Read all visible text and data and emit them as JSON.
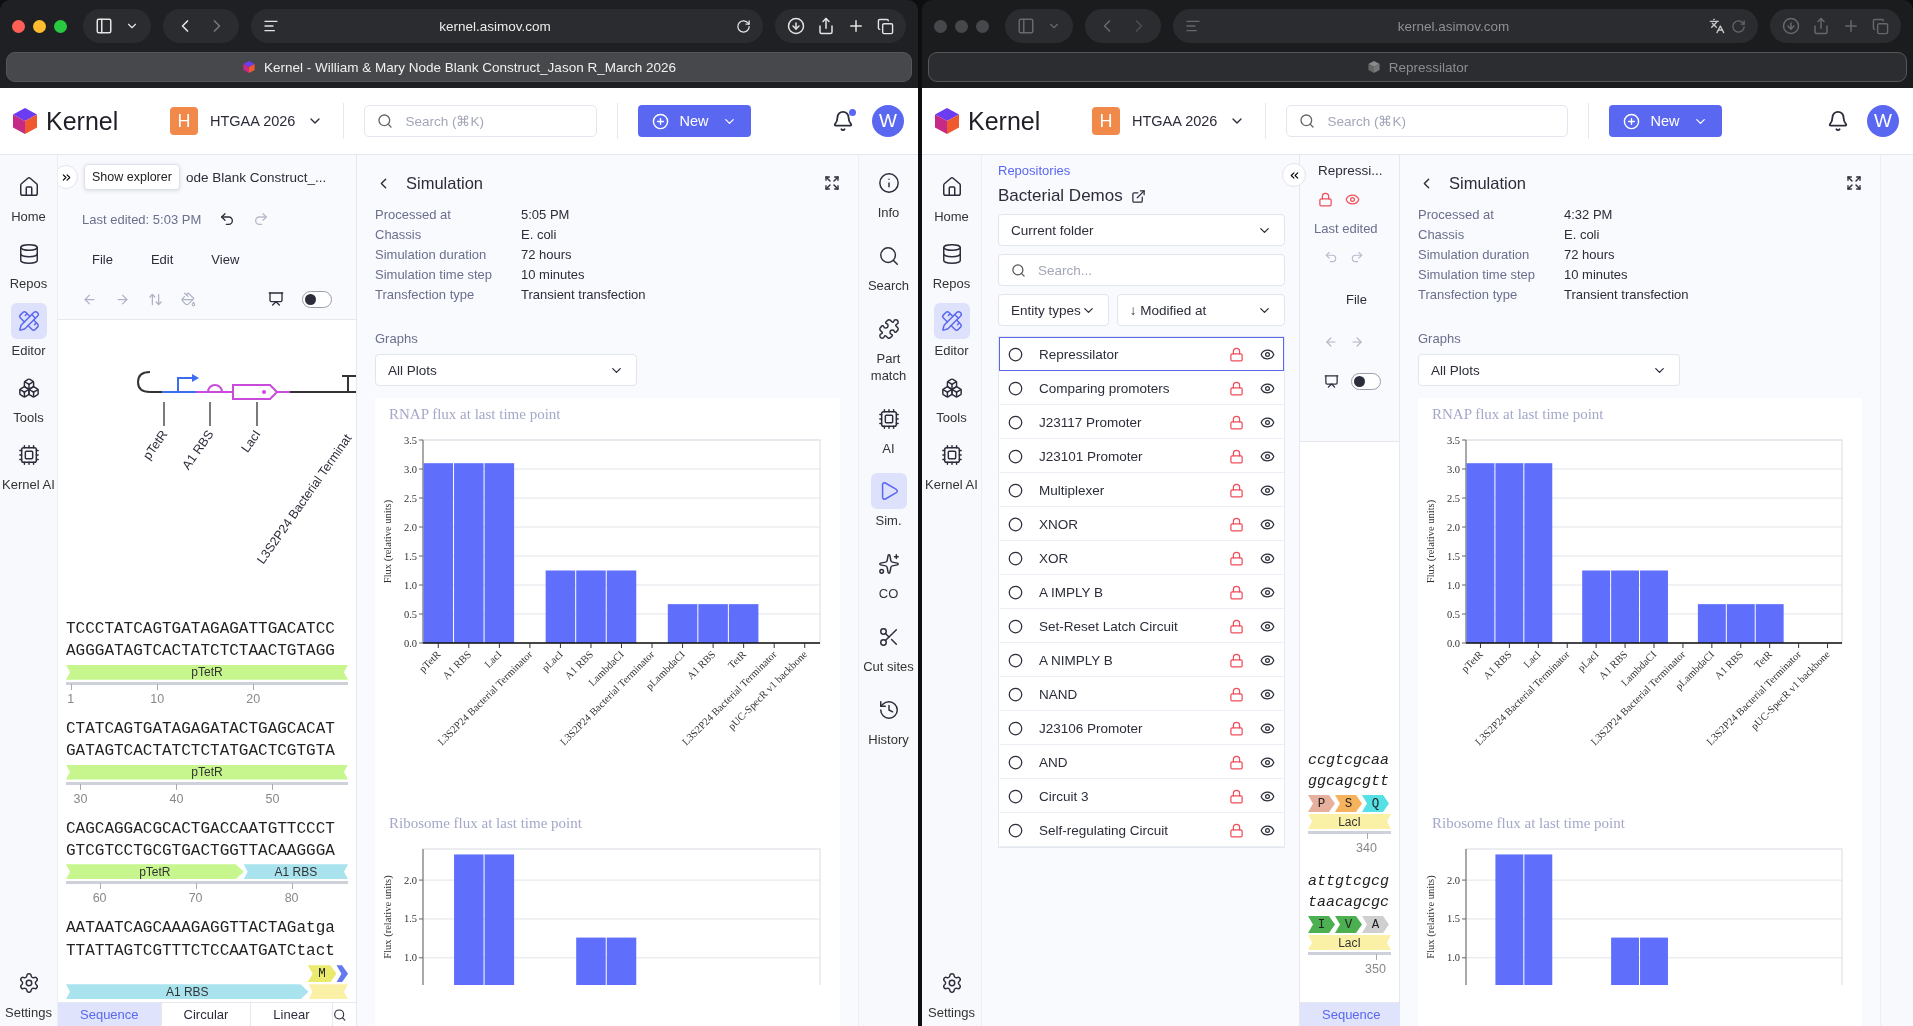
{
  "windows": [
    {
      "active": true,
      "url": "kernel.asimov.com",
      "tab_title": "Kernel - William & Mary Node Blank Construct_Jason R_March 2026",
      "app": {
        "brand": "Kernel",
        "workspace_initial": "H",
        "workspace": "HTGAA 2026",
        "search_placeholder": "Search (⌘K)",
        "new_label": "New",
        "unread": true,
        "avatar": "W"
      },
      "nav": [
        {
          "label": "Home",
          "kind": "home",
          "selected": false
        },
        {
          "label": "Repos",
          "kind": "repos",
          "selected": false
        },
        {
          "label": "Editor",
          "kind": "editor",
          "selected": true
        },
        {
          "label": "Tools",
          "kind": "tools",
          "selected": false
        },
        {
          "label": "Kernel AI",
          "kind": "ai",
          "selected": false
        }
      ],
      "settings": "Settings",
      "editor": {
        "kind": "full",
        "tooltip": "Show explorer",
        "title": "ode Blank Construct_...",
        "last_edited": "Last edited: 5:03 PM",
        "menus": [
          "File",
          "Edit",
          "View"
        ],
        "toggle_on": false,
        "diagram_labels": [
          "pTetR",
          "A1 RBS",
          "LacI",
          "L3S2P24 Bacterial Terminat"
        ],
        "blocks": [
          {
            "top": "TCCCTATCAGTGATAGAGATTGACATCC",
            "bottom": "AGGGATAGTCACTATCTCTAACTGTAGG",
            "features": [
              {
                "label": "pTetR",
                "color": "#c6f68d",
                "ends": false
              }
            ],
            "ticks": [
              "1",
              "10",
              "20"
            ]
          },
          {
            "top": "CTATCAGTGATAGAGATACTGAGCACAT",
            "bottom": "GATAGTCACTATCTCTATGACTCGTGTA",
            "features": [
              {
                "label": "pTetR",
                "color": "#c6f68d",
                "ends": false
              }
            ],
            "ticks": [
              "30",
              "40",
              "50"
            ]
          },
          {
            "top": "CAGCAGGACGCACTGACCAATGTTCCCT",
            "bottom": "GTCGTCCTGCGTGACTGGTTACAAGGGA",
            "features": [
              {
                "label": "pTetR",
                "color": "#c6f68d",
                "ends": true
              },
              {
                "label": "A1 RBS",
                "color": "#a9e3ee",
                "ends": false
              }
            ],
            "ticks": [
              "60",
              "70",
              "80"
            ]
          },
          {
            "top": "AATAATCAGCAAAGAGGTTACTAGatga",
            "bottom": "TTATTAGTCGTTTCTCCAATGATCtact",
            "aminos": [
              {
                "label": "M",
                "color": "#e9ea6e"
              },
              {
                "color": "#6478f0"
              }
            ],
            "features": [
              {
                "label": "A1 RBS",
                "color": "#a9e3ee",
                "ends": true
              },
              {
                "color": "#fbf1a6",
                "ends": false
              }
            ]
          }
        ],
        "tabs": [
          {
            "label": "Sequence",
            "selected": true
          },
          {
            "label": "Circular",
            "selected": false
          },
          {
            "label": "Linear",
            "selected": false
          }
        ]
      },
      "simulation": {
        "title": "Simulation",
        "properties": [
          {
            "label": "Processed at",
            "value": "5:05 PM"
          },
          {
            "label": "Chassis",
            "value": "E. coli"
          },
          {
            "label": "Simulation duration",
            "value": "72 hours"
          },
          {
            "label": "Simulation time step",
            "value": "10 minutes"
          },
          {
            "label": "Transfection type",
            "value": "Transient transfection"
          }
        ],
        "graphs_label": "Graphs",
        "plot_select": "All Plots",
        "charts": [
          {
            "title": "RNAP flux at last time point",
            "chart_data": {
              "type": "bar",
              "ylabel": "Flux (relative units)",
              "categories": [
                "pTetR",
                "A1 RBS",
                "LacI",
                "L3S2P24 Bacterial Terminator",
                "pLacI",
                "A1 RBS",
                "LambdaCI",
                "L3S2P24 Bacterial Terminator",
                "pLambdaCI",
                "A1 RBS",
                "TetR",
                "L3S2P24 Bacterial Terminator",
                "pUC-SpecR v1 backbone"
              ],
              "values": [
                3.1,
                3.1,
                3.1,
                0,
                1.25,
                1.25,
                1.25,
                0,
                0.67,
                0.67,
                0.67,
                0,
                0
              ],
              "ylim": [
                0,
                3.5
              ],
              "grid": true,
              "yticks": [
                {
                  "value": 0,
                  "label": "0.0"
                },
                {
                  "value": 0.5,
                  "label": "0.5"
                },
                {
                  "value": 1,
                  "label": "1.0"
                },
                {
                  "value": 1.5,
                  "label": "1.5"
                },
                {
                  "value": 2,
                  "label": "2.0"
                },
                {
                  "value": 2.5,
                  "label": "2.5"
                },
                {
                  "value": 3,
                  "label": "3.0"
                },
                {
                  "value": 3.5,
                  "label": "3.5"
                }
              ]
            }
          },
          {
            "title": "Ribosome flux at last time point",
            "chart_data": {
              "type": "bar",
              "ylabel": "Flux (relative units)",
              "values": [
                null,
                2.33,
                2.33,
                null,
                null,
                1.26,
                1.26,
                null,
                null,
                null,
                null,
                null,
                null
              ],
              "ylim": [
                0.65,
                2.4
              ],
              "grid": true,
              "yticks": [
                {
                  "value": 1,
                  "label": "1.0"
                },
                {
                  "value": 1.5,
                  "label": "1.5"
                },
                {
                  "value": 2,
                  "label": "2.0"
                }
              ]
            }
          }
        ]
      },
      "tools_rail": [
        {
          "label": "Info",
          "kind": "info",
          "selected": false
        },
        {
          "label": "Search",
          "kind": "search",
          "selected": false
        },
        {
          "label": "Part match",
          "kind": "partmatch",
          "selected": false
        },
        {
          "label": "AI",
          "kind": "ai",
          "selected": false
        },
        {
          "label": "Sim.",
          "kind": "sim",
          "selected": true
        },
        {
          "label": "CO",
          "kind": "co",
          "selected": false
        },
        {
          "label": "Cut sites",
          "kind": "cutsites",
          "selected": false
        },
        {
          "label": "History",
          "kind": "history",
          "selected": false
        }
      ]
    },
    {
      "active": false,
      "url": "kernel.asimov.com",
      "tab_title": "Repressilator",
      "app": {
        "brand": "Kernel",
        "workspace_initial": "H",
        "workspace": "HTGAA 2026",
        "search_placeholder": "Search (⌘K)",
        "new_label": "New",
        "unread": false,
        "avatar": "W"
      },
      "nav": [
        {
          "label": "Home",
          "kind": "home",
          "selected": false
        },
        {
          "label": "Repos",
          "kind": "repos",
          "selected": false
        },
        {
          "label": "Editor",
          "kind": "editor",
          "selected": true
        },
        {
          "label": "Tools",
          "kind": "tools",
          "selected": false
        },
        {
          "label": "Kernel AI",
          "kind": "ai",
          "selected": false
        }
      ],
      "settings": "Settings",
      "explorer": {
        "breadcrumb": "Repositories",
        "title": "Bacterial Demos",
        "folder": "Current folder",
        "search_placeholder": "Search...",
        "filters": [
          "Entity types",
          "↓ Modified at"
        ],
        "items": [
          {
            "name": "Repressilator",
            "selected": true
          },
          {
            "name": "Comparing promoters",
            "selected": false
          },
          {
            "name": "J23117 Promoter",
            "selected": false
          },
          {
            "name": "J23101 Promoter",
            "selected": false
          },
          {
            "name": "Multiplexer",
            "selected": false
          },
          {
            "name": "XNOR",
            "selected": false
          },
          {
            "name": "XOR",
            "selected": false
          },
          {
            "name": "A IMPLY B",
            "selected": false
          },
          {
            "name": "Set-Reset Latch Circuit",
            "selected": false
          },
          {
            "name": "A NIMPLY B",
            "selected": false
          },
          {
            "name": "NAND",
            "selected": false
          },
          {
            "name": "J23106 Promoter",
            "selected": false
          },
          {
            "name": "AND",
            "selected": false
          },
          {
            "name": "Circuit 3",
            "selected": false
          },
          {
            "name": "Self-regulating Circuit",
            "selected": false
          }
        ]
      },
      "editor": {
        "kind": "narrow",
        "title": "Repressi...",
        "last_edited": "Last edited",
        "menus": [
          "File"
        ],
        "toggle_on": false,
        "blocks": [
          {
            "top": "ccgtcgcaa",
            "bottom": "ggcagcgtt",
            "aminos": [
              {
                "label": "P",
                "color": "#e7b09e"
              },
              {
                "label": "S",
                "color": "#f4b35c"
              },
              {
                "label": "Q",
                "color": "#55e0e6"
              }
            ],
            "features": [
              {
                "label": "LacI",
                "color": "#fbf1a6",
                "ends": false
              }
            ],
            "ticks": [
              "340"
            ]
          },
          {
            "top": "attgtcgcg",
            "bottom": "taacagcgc",
            "aminos": [
              {
                "label": "I",
                "color": "#4caf50"
              },
              {
                "label": "V",
                "color": "#4caf50"
              },
              {
                "label": "A",
                "color": "#cfcfcf"
              }
            ],
            "features": [
              {
                "label": "LacI",
                "color": "#fbf1a6",
                "ends": false
              }
            ],
            "ticks": [
              "350"
            ]
          }
        ],
        "tabs": [
          {
            "label": "Sequence",
            "selected": true
          }
        ]
      },
      "simulation": {
        "title": "Simulation",
        "properties": [
          {
            "label": "Processed at",
            "value": "4:32 PM"
          },
          {
            "label": "Chassis",
            "value": "E. coli"
          },
          {
            "label": "Simulation duration",
            "value": "72 hours"
          },
          {
            "label": "Simulation time step",
            "value": "10 minutes"
          },
          {
            "label": "Transfection type",
            "value": "Transient transfection"
          }
        ],
        "graphs_label": "Graphs",
        "plot_select": "All Plots",
        "charts": [
          {
            "title": "RNAP flux at last time point",
            "chart_data": {
              "type": "bar",
              "ylabel": "Flux (relative units)",
              "categories": [
                "pTetR",
                "A1 RBS",
                "LacI",
                "L3S2P24 Bacterial Terminator",
                "pLacI",
                "A1 RBS",
                "LambdaCI",
                "L3S2P24 Bacterial Terminator",
                "pLambdaCI",
                "A1 RBS",
                "TetR",
                "L3S2P24 Bacterial Terminator",
                "pUC-SpecR v1 backbone"
              ],
              "values": [
                3.1,
                3.1,
                3.1,
                0,
                1.25,
                1.25,
                1.25,
                0,
                0.67,
                0.67,
                0.67,
                0,
                0
              ],
              "ylim": [
                0,
                3.5
              ],
              "grid": true,
              "yticks": [
                {
                  "value": 0,
                  "label": "0.0"
                },
                {
                  "value": 0.5,
                  "label": "0.5"
                },
                {
                  "value": 1,
                  "label": "1.0"
                },
                {
                  "value": 1.5,
                  "label": "1.5"
                },
                {
                  "value": 2,
                  "label": "2.0"
                },
                {
                  "value": 2.5,
                  "label": "2.5"
                },
                {
                  "value": 3,
                  "label": "3.0"
                },
                {
                  "value": 3.5,
                  "label": "3.5"
                }
              ]
            }
          },
          {
            "title": "Ribosome flux at last time point",
            "chart_data": {
              "type": "bar",
              "ylabel": "Flux (relative units)",
              "values": [
                null,
                2.33,
                2.33,
                null,
                null,
                1.26,
                1.26,
                null,
                null,
                null,
                null,
                null,
                null
              ],
              "ylim": [
                0.65,
                2.4
              ],
              "grid": true,
              "yticks": [
                {
                  "value": 1,
                  "label": "1.0"
                },
                {
                  "value": 1.5,
                  "label": "1.5"
                },
                {
                  "value": 2,
                  "label": "2.0"
                }
              ]
            }
          }
        ]
      }
    }
  ]
}
